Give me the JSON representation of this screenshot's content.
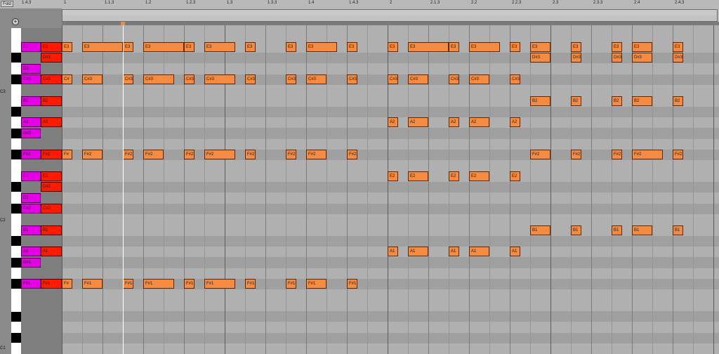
{
  "toolbar": {
    "fold_label": "Fold"
  },
  "ruler": {
    "bars": [
      "1.4.3",
      "1",
      "1.1.3",
      "1.2",
      "1.2.3",
      "1.3",
      "1.3.3",
      "1.4",
      "1.4.3",
      "2",
      "2.1.3",
      "2.2",
      "2.2.3",
      "2.3",
      "2.3.3",
      "2.4",
      "2.4.3"
    ]
  },
  "octave_labels": [
    "C3",
    "C2",
    "C1"
  ],
  "pitch_rows": [
    "E3",
    "D#3",
    "D3",
    "C#3",
    "C3",
    "B2",
    "A#2",
    "A2",
    "G#2",
    "G2",
    "F#2",
    "F2",
    "E2",
    "D#2",
    "D2",
    "C#2",
    "C2",
    "B1",
    "A#1",
    "A1",
    "G#1",
    "G1",
    "F#1",
    "F1",
    "E1",
    "D#1",
    "D1",
    "C#1",
    "C1"
  ],
  "gutter_notes": {
    "magenta": [
      {
        "label": "E3",
        "pitch": "E3"
      },
      {
        "label": "D3",
        "pitch": "D3"
      },
      {
        "label": "C#3",
        "pitch": "C#3"
      },
      {
        "label": "B2",
        "pitch": "B2"
      },
      {
        "label": "A2",
        "pitch": "A2"
      },
      {
        "label": "G#2",
        "pitch": "G#2"
      },
      {
        "label": "F#2",
        "pitch": "F#2"
      },
      {
        "label": "E2",
        "pitch": "E2"
      },
      {
        "label": "D2",
        "pitch": "D2"
      },
      {
        "label": "C#2",
        "pitch": "C#2"
      },
      {
        "label": "B1",
        "pitch": "B1"
      },
      {
        "label": "A1",
        "pitch": "A1"
      },
      {
        "label": "G#1",
        "pitch": "G#1"
      },
      {
        "label": "F#1",
        "pitch": "F#1"
      }
    ],
    "red": [
      {
        "label": "E3",
        "pitch": "E3"
      },
      {
        "label": "D#3",
        "pitch": "D#3"
      },
      {
        "label": "C#3",
        "pitch": "C#3"
      },
      {
        "label": "B2",
        "pitch": "B2"
      },
      {
        "label": "A2",
        "pitch": "A2"
      },
      {
        "label": "F#2",
        "pitch": "F#2"
      },
      {
        "label": "E2",
        "pitch": "E2"
      },
      {
        "label": "D#2",
        "pitch": "D#2"
      },
      {
        "label": "C#2",
        "pitch": "C#2"
      },
      {
        "label": "B1",
        "pitch": "B1"
      },
      {
        "label": "A1",
        "pitch": "A1"
      },
      {
        "label": "F#1",
        "pitch": "F#1"
      }
    ]
  },
  "notes": [
    {
      "label": "E3",
      "pitch": "E3",
      "start": 0,
      "len": 0.5
    },
    {
      "label": "E3",
      "pitch": "E3",
      "start": 1,
      "len": 2
    },
    {
      "label": "E3",
      "pitch": "E3",
      "start": 3,
      "len": 0.5
    },
    {
      "label": "E3",
      "pitch": "E3",
      "start": 4,
      "len": 2
    },
    {
      "label": "E3",
      "pitch": "E3",
      "start": 6,
      "len": 0.5
    },
    {
      "label": "E3",
      "pitch": "E3",
      "start": 7,
      "len": 1.5
    },
    {
      "label": "E3",
      "pitch": "E3",
      "start": 9,
      "len": 0.5
    },
    {
      "label": "E3",
      "pitch": "E3",
      "start": 11,
      "len": 0.5
    },
    {
      "label": "E3",
      "pitch": "E3",
      "start": 12,
      "len": 1.5
    },
    {
      "label": "E3",
      "pitch": "E3",
      "start": 14,
      "len": 0.5
    },
    {
      "label": "E3",
      "pitch": "E3",
      "start": 16,
      "len": 0.5
    },
    {
      "label": "E3",
      "pitch": "E3",
      "start": 17,
      "len": 2
    },
    {
      "label": "E3",
      "pitch": "E3",
      "start": 19,
      "len": 0.5
    },
    {
      "label": "E3",
      "pitch": "E3",
      "start": 20,
      "len": 1.5
    },
    {
      "label": "E3",
      "pitch": "E3",
      "start": 22,
      "len": 0.5
    },
    {
      "label": "E3",
      "pitch": "E3",
      "start": 23,
      "len": 1
    },
    {
      "label": "E3",
      "pitch": "E3",
      "start": 25,
      "len": 0.5
    },
    {
      "label": "E3",
      "pitch": "E3",
      "start": 27,
      "len": 0.5
    },
    {
      "label": "E3",
      "pitch": "E3",
      "start": 28,
      "len": 1
    },
    {
      "label": "E3",
      "pitch": "E3",
      "start": 30,
      "len": 0.5
    },
    {
      "label": "D#3",
      "pitch": "D#3",
      "start": 23,
      "len": 1
    },
    {
      "label": "D#3",
      "pitch": "D#3",
      "start": 25,
      "len": 0.5
    },
    {
      "label": "D#3",
      "pitch": "D#3",
      "start": 27,
      "len": 0.5
    },
    {
      "label": "D#3",
      "pitch": "D#3",
      "start": 28,
      "len": 1
    },
    {
      "label": "D#3",
      "pitch": "D#3",
      "start": 30,
      "len": 0.5
    },
    {
      "label": "C#",
      "pitch": "C#3",
      "start": 0,
      "len": 0.5
    },
    {
      "label": "C#3",
      "pitch": "C#3",
      "start": 1,
      "len": 1
    },
    {
      "label": "C#3",
      "pitch": "C#3",
      "start": 3,
      "len": 0.5
    },
    {
      "label": "C#3",
      "pitch": "C#3",
      "start": 4,
      "len": 1.5
    },
    {
      "label": "C#3",
      "pitch": "C#3",
      "start": 6,
      "len": 0.5
    },
    {
      "label": "C#3",
      "pitch": "C#3",
      "start": 7,
      "len": 1.5
    },
    {
      "label": "C#3",
      "pitch": "C#3",
      "start": 9,
      "len": 0.5
    },
    {
      "label": "C#3",
      "pitch": "C#3",
      "start": 11,
      "len": 0.5
    },
    {
      "label": "C#3",
      "pitch": "C#3",
      "start": 12,
      "len": 1
    },
    {
      "label": "C#3",
      "pitch": "C#3",
      "start": 14,
      "len": 0.5
    },
    {
      "label": "C#3",
      "pitch": "C#3",
      "start": 16,
      "len": 0.5
    },
    {
      "label": "C#3",
      "pitch": "C#3",
      "start": 17,
      "len": 1
    },
    {
      "label": "C#3",
      "pitch": "C#3",
      "start": 19,
      "len": 0.5
    },
    {
      "label": "C#3",
      "pitch": "C#3",
      "start": 20,
      "len": 1
    },
    {
      "label": "C#3",
      "pitch": "C#3",
      "start": 22,
      "len": 0.5
    },
    {
      "label": "B2",
      "pitch": "B2",
      "start": 23,
      "len": 1
    },
    {
      "label": "B2",
      "pitch": "B2",
      "start": 25,
      "len": 0.5
    },
    {
      "label": "B2",
      "pitch": "B2",
      "start": 27,
      "len": 0.5
    },
    {
      "label": "B2",
      "pitch": "B2",
      "start": 28,
      "len": 1
    },
    {
      "label": "B2",
      "pitch": "B2",
      "start": 30,
      "len": 0.5
    },
    {
      "label": "A2",
      "pitch": "A2",
      "start": 16,
      "len": 0.5
    },
    {
      "label": "A2",
      "pitch": "A2",
      "start": 17,
      "len": 1
    },
    {
      "label": "A2",
      "pitch": "A2",
      "start": 19,
      "len": 0.5
    },
    {
      "label": "A2",
      "pitch": "A2",
      "start": 20,
      "len": 1
    },
    {
      "label": "A2",
      "pitch": "A2",
      "start": 22,
      "len": 0.5
    },
    {
      "label": "F#",
      "pitch": "F#2",
      "start": 0,
      "len": 0.5
    },
    {
      "label": "F#2",
      "pitch": "F#2",
      "start": 1,
      "len": 1
    },
    {
      "label": "F#2",
      "pitch": "F#2",
      "start": 3,
      "len": 0.5
    },
    {
      "label": "F#2",
      "pitch": "F#2",
      "start": 4,
      "len": 1
    },
    {
      "label": "F#2",
      "pitch": "F#2",
      "start": 6,
      "len": 0.5
    },
    {
      "label": "F#2",
      "pitch": "F#2",
      "start": 7,
      "len": 1.5
    },
    {
      "label": "F#2",
      "pitch": "F#2",
      "start": 9,
      "len": 0.5
    },
    {
      "label": "F#2",
      "pitch": "F#2",
      "start": 11,
      "len": 0.5
    },
    {
      "label": "F#2",
      "pitch": "F#2",
      "start": 12,
      "len": 1
    },
    {
      "label": "F#2",
      "pitch": "F#2",
      "start": 14,
      "len": 0.5
    },
    {
      "label": "F#2",
      "pitch": "F#2",
      "start": 23,
      "len": 1
    },
    {
      "label": "F#2",
      "pitch": "F#2",
      "start": 25,
      "len": 0.5
    },
    {
      "label": "F#2",
      "pitch": "F#2",
      "start": 27,
      "len": 0.5
    },
    {
      "label": "F#2",
      "pitch": "F#2",
      "start": 28,
      "len": 1.5
    },
    {
      "label": "F#2",
      "pitch": "F#2",
      "start": 30,
      "len": 0.5
    },
    {
      "label": "E2",
      "pitch": "E2",
      "start": 16,
      "len": 0.5
    },
    {
      "label": "E2",
      "pitch": "E2",
      "start": 17,
      "len": 1
    },
    {
      "label": "E2",
      "pitch": "E2",
      "start": 19,
      "len": 0.5
    },
    {
      "label": "E2",
      "pitch": "E2",
      "start": 20,
      "len": 1
    },
    {
      "label": "E2",
      "pitch": "E2",
      "start": 22,
      "len": 0.5
    },
    {
      "label": "B1",
      "pitch": "B1",
      "start": 23,
      "len": 1
    },
    {
      "label": "B1",
      "pitch": "B1",
      "start": 25,
      "len": 0.5
    },
    {
      "label": "B1",
      "pitch": "B1",
      "start": 27,
      "len": 0.5
    },
    {
      "label": "B1",
      "pitch": "B1",
      "start": 28,
      "len": 1
    },
    {
      "label": "B1",
      "pitch": "B1",
      "start": 30,
      "len": 0.5
    },
    {
      "label": "A1",
      "pitch": "A1",
      "start": 16,
      "len": 0.5
    },
    {
      "label": "A1",
      "pitch": "A1",
      "start": 17,
      "len": 1
    },
    {
      "label": "A1",
      "pitch": "A1",
      "start": 19,
      "len": 0.5
    },
    {
      "label": "A1",
      "pitch": "A1",
      "start": 20,
      "len": 1
    },
    {
      "label": "A1",
      "pitch": "A1",
      "start": 22,
      "len": 0.5
    },
    {
      "label": "F#",
      "pitch": "F#1",
      "start": 0,
      "len": 0.5
    },
    {
      "label": "F#1",
      "pitch": "F#1",
      "start": 1,
      "len": 1
    },
    {
      "label": "F#1",
      "pitch": "F#1",
      "start": 3,
      "len": 0.5
    },
    {
      "label": "F#1",
      "pitch": "F#1",
      "start": 4,
      "len": 1.5
    },
    {
      "label": "F#1",
      "pitch": "F#1",
      "start": 6,
      "len": 0.5
    },
    {
      "label": "F#1",
      "pitch": "F#1",
      "start": 7,
      "len": 1.5
    },
    {
      "label": "F#1",
      "pitch": "F#1",
      "start": 9,
      "len": 0.5
    },
    {
      "label": "F#1",
      "pitch": "F#1",
      "start": 11,
      "len": 0.5
    },
    {
      "label": "F#1",
      "pitch": "F#1",
      "start": 12,
      "len": 1
    },
    {
      "label": "F#1",
      "pitch": "F#1",
      "start": 14,
      "len": 0.5
    }
  ],
  "colors": {
    "note": "#f58a41",
    "magenta": "#e600e6",
    "red": "#ff1a00"
  }
}
